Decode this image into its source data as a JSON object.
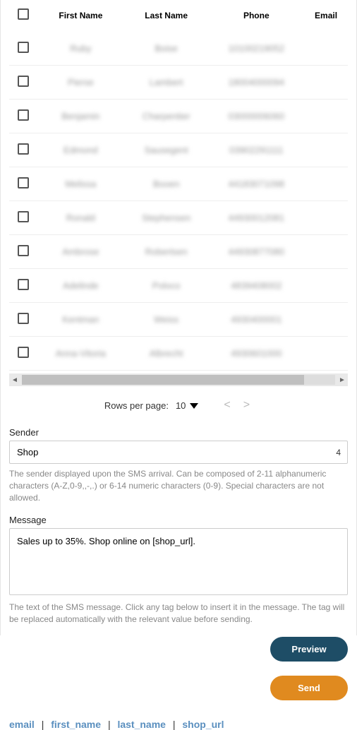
{
  "table": {
    "headers": {
      "first_name": "First Name",
      "last_name": "Last Name",
      "phone": "Phone",
      "email": "Email"
    },
    "rows": [
      {
        "first_name": "Ruby",
        "last_name": "Boise",
        "phone": "10100219052",
        "email": ""
      },
      {
        "first_name": "Pierse",
        "last_name": "Lambert",
        "phone": "18004000094",
        "email": ""
      },
      {
        "first_name": "Benjamin",
        "last_name": "Charpentier",
        "phone": "03000006060",
        "email": ""
      },
      {
        "first_name": "Edmond",
        "last_name": "Sausegent",
        "phone": "03902291111",
        "email": ""
      },
      {
        "first_name": "Melissa",
        "last_name": "Booen",
        "phone": "44183071098",
        "email": ""
      },
      {
        "first_name": "Ronald",
        "last_name": "Stephensen",
        "phone": "44930012081",
        "email": ""
      },
      {
        "first_name": "Ambrose",
        "last_name": "Robertsen",
        "phone": "44930877080",
        "email": ""
      },
      {
        "first_name": "Adelinde",
        "last_name": "Poloco",
        "phone": "4839408002",
        "email": ""
      },
      {
        "first_name": "Kentman",
        "last_name": "Weiss",
        "phone": "4930400001",
        "email": ""
      },
      {
        "first_name": "Anna-Vitoria",
        "last_name": "Albrecht",
        "phone": "4930601000",
        "email": ""
      }
    ]
  },
  "pager": {
    "label": "Rows per page:",
    "value": "10"
  },
  "sender": {
    "label": "Sender",
    "value": "Shop",
    "remaining": "4",
    "help": "The sender displayed upon the SMS arrival. Can be composed of 2-11 alphanumeric characters (A-Z,0-9,,-,.) or 6-14 numeric characters (0-9). Special characters are not allowed."
  },
  "message": {
    "label": "Message",
    "value": "Sales up to 35%. Shop online on [shop_url].",
    "help": "The text of the SMS message. Click any tag below to insert it in the message. The tag will be replaced automatically with the relevant value before sending."
  },
  "buttons": {
    "preview": "Preview",
    "send": "Send"
  },
  "tags": {
    "email": "email",
    "first_name": "first_name",
    "last_name": "last_name",
    "shop_url": "shop_url"
  }
}
